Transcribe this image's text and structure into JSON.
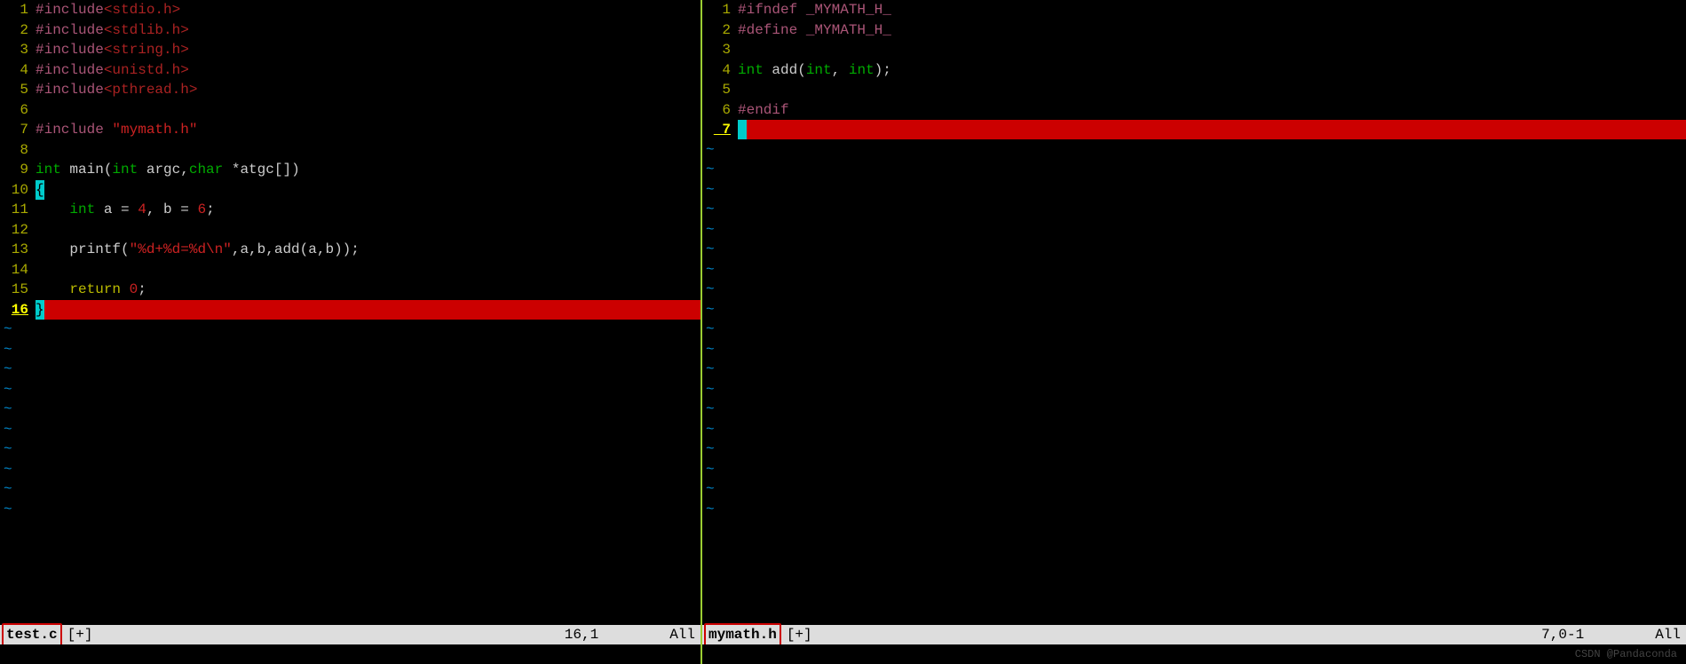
{
  "left": {
    "filename": "test.c",
    "modified": "[+]",
    "position": "16,1",
    "view": "All",
    "lines": [
      {
        "n": 1,
        "tokens": [
          [
            "c-pre",
            "#include"
          ],
          [
            "c-inc",
            "<stdio.h>"
          ]
        ]
      },
      {
        "n": 2,
        "tokens": [
          [
            "c-pre",
            "#include"
          ],
          [
            "c-inc",
            "<stdlib.h>"
          ]
        ]
      },
      {
        "n": 3,
        "tokens": [
          [
            "c-pre",
            "#include"
          ],
          [
            "c-inc",
            "<string.h>"
          ]
        ]
      },
      {
        "n": 4,
        "tokens": [
          [
            "c-pre",
            "#include"
          ],
          [
            "c-inc",
            "<unistd.h>"
          ]
        ]
      },
      {
        "n": 5,
        "tokens": [
          [
            "c-pre",
            "#include"
          ],
          [
            "c-inc",
            "<pthread.h>"
          ]
        ]
      },
      {
        "n": 6,
        "tokens": []
      },
      {
        "n": 7,
        "tokens": [
          [
            "c-pre",
            "#include "
          ],
          [
            "c-str",
            "\"mymath.h\""
          ]
        ]
      },
      {
        "n": 8,
        "tokens": []
      },
      {
        "n": 9,
        "tokens": [
          [
            "c-kw",
            "int"
          ],
          [
            "c-txt",
            " main("
          ],
          [
            "c-kw",
            "int"
          ],
          [
            "c-txt",
            " argc,"
          ],
          [
            "c-kw",
            "char"
          ],
          [
            "c-txt",
            " *atgc[])"
          ]
        ]
      },
      {
        "n": 10,
        "tokens": [
          [
            "brace-open",
            "{"
          ]
        ]
      },
      {
        "n": 11,
        "tokens": [
          [
            "c-txt",
            "    "
          ],
          [
            "c-kw",
            "int"
          ],
          [
            "c-txt",
            " a = "
          ],
          [
            "c-num",
            "4"
          ],
          [
            "c-txt",
            ", b = "
          ],
          [
            "c-num",
            "6"
          ],
          [
            "c-txt",
            ";"
          ]
        ]
      },
      {
        "n": 12,
        "tokens": []
      },
      {
        "n": 13,
        "tokens": [
          [
            "c-txt",
            "    printf("
          ],
          [
            "c-str",
            "\"%d+%d=%d\\n\""
          ],
          [
            "c-txt",
            ",a,b,add(a,b));"
          ]
        ]
      },
      {
        "n": 14,
        "tokens": []
      },
      {
        "n": 15,
        "tokens": [
          [
            "c-txt",
            "    "
          ],
          [
            "c-ret",
            "return"
          ],
          [
            "c-txt",
            " "
          ],
          [
            "c-num",
            "0"
          ],
          [
            "c-txt",
            ";"
          ]
        ]
      },
      {
        "n": 16,
        "current": true,
        "hl": true,
        "tokens": [
          [
            "brace-close",
            "}"
          ]
        ]
      }
    ],
    "tildes": 10
  },
  "right": {
    "filename": "mymath.h",
    "modified": "[+]",
    "position": "7,0-1",
    "view": "All",
    "lines": [
      {
        "n": 1,
        "tokens": [
          [
            "c-pre",
            "#ifndef _MYMATH_H_"
          ]
        ]
      },
      {
        "n": 2,
        "tokens": [
          [
            "c-pre",
            "#define _MYMATH_H_"
          ]
        ]
      },
      {
        "n": 3,
        "tokens": []
      },
      {
        "n": 4,
        "tokens": [
          [
            "c-kw",
            "int"
          ],
          [
            "c-txt",
            " add("
          ],
          [
            "c-kw",
            "int"
          ],
          [
            "c-txt",
            ", "
          ],
          [
            "c-kw",
            "int"
          ],
          [
            "c-txt",
            ");"
          ]
        ]
      },
      {
        "n": 5,
        "tokens": []
      },
      {
        "n": 6,
        "tokens": [
          [
            "c-pre",
            "#endif"
          ]
        ]
      },
      {
        "n": 7,
        "current": true,
        "hl": true,
        "cursor": true,
        "tokens": []
      }
    ],
    "tildes": 19
  },
  "watermark": "CSDN @Pandaconda"
}
